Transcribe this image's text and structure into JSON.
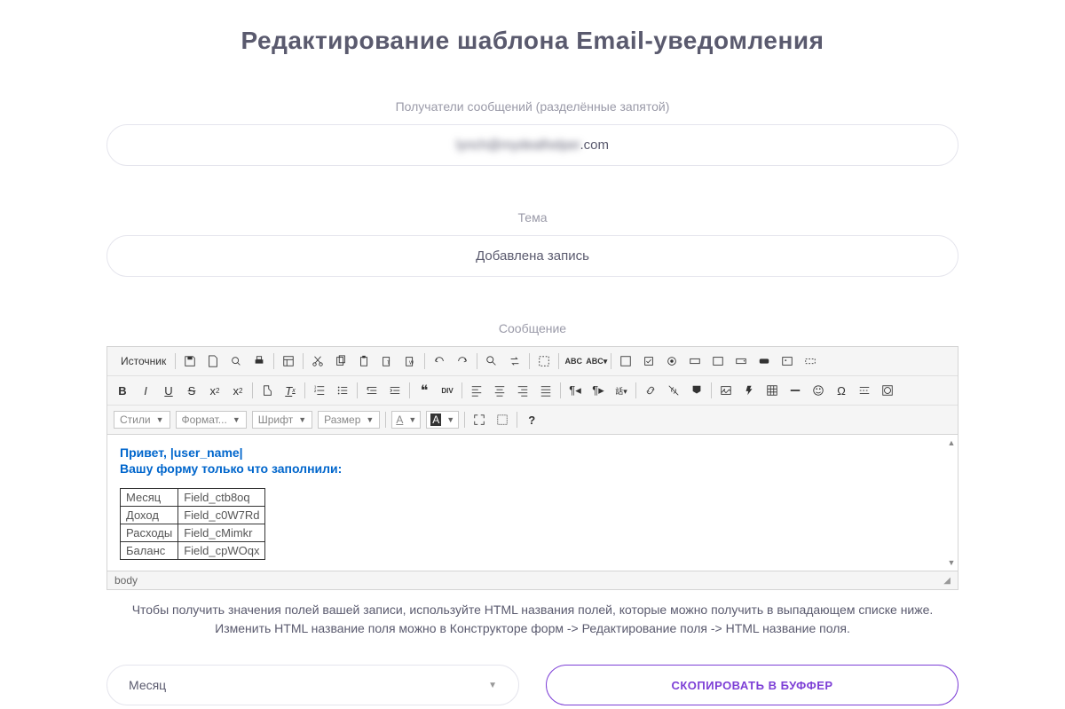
{
  "title": "Редактирование шаблона Email-уведомления",
  "recipients": {
    "label": "Получатели сообщений (разделённые запятой)",
    "value_blur": "lynch@mydealhelper",
    "value_suffix": ".com"
  },
  "subject": {
    "label": "Тема",
    "value": "Добавлена запись"
  },
  "message": {
    "label": "Сообщение",
    "source_btn": "Источник",
    "styles_dd": "Стили",
    "format_dd": "Формат...",
    "font_dd": "Шрифт",
    "size_dd": "Размер",
    "greeting": "Привет, |user_name|",
    "filled": "Вашу форму только что заполнили:",
    "table": [
      {
        "label": "Месяц",
        "field": "Field_ctb8oq"
      },
      {
        "label": "Доход",
        "field": "Field_c0W7Rd"
      },
      {
        "label": "Расходы",
        "field": "Field_cMimkr"
      },
      {
        "label": "Баланс",
        "field": "Field_cpWOqx"
      }
    ],
    "path": "body"
  },
  "help": {
    "line1": "Чтобы получить значения полей вашей записи, используйте HTML названия полей, которые можно получить в выпадающем списке ниже.",
    "line2": "Изменить HTML название поля можно в Конструкторе форм -> Редактирование поля -> HTML название поля."
  },
  "actions": {
    "select_value": "Месяц",
    "copy_btn": "СКОПИРОВАТЬ В БУФФЕР"
  }
}
